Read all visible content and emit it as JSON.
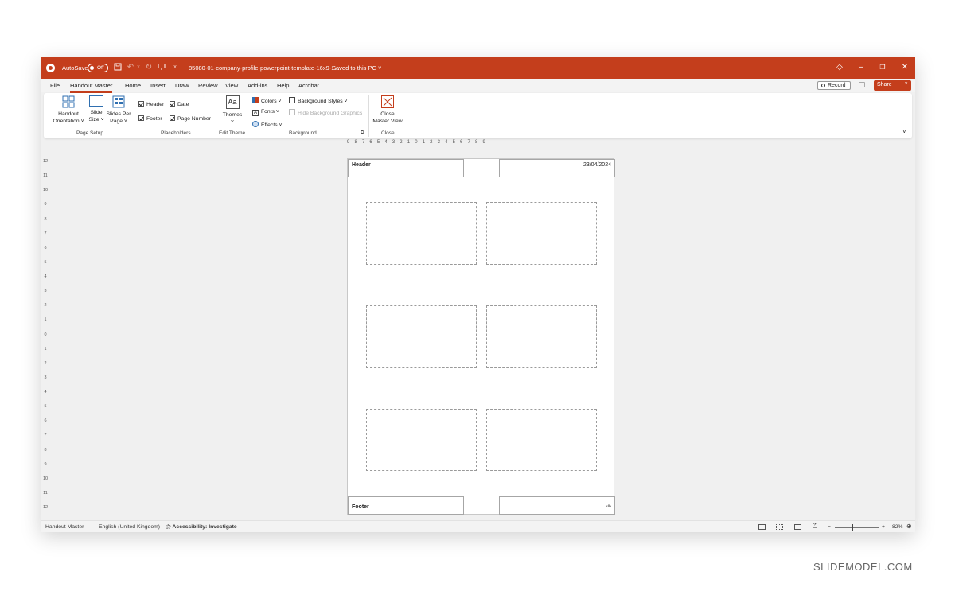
{
  "titlebar": {
    "autosave_label": "AutoSave",
    "autosave_state": "Off",
    "filename": "85080-01-company-profile-powerpoint-template-16x9-1....",
    "save_status": "Saved to this PC",
    "brand_color": "#c43e1c"
  },
  "menu": {
    "items": [
      "File",
      "Handout Master",
      "Home",
      "Insert",
      "Draw",
      "Review",
      "View",
      "Add-ins",
      "Help",
      "Acrobat"
    ],
    "active": "Handout Master",
    "record_label": "Record",
    "share_label": "Share"
  },
  "ribbon": {
    "page_setup": {
      "label": "Page Setup",
      "handout_orientation": [
        "Handout",
        "Orientation ˅"
      ],
      "slide_size": [
        "Slide",
        "Size ˅"
      ],
      "slides_per_page": [
        "Slides Per",
        "Page ˅"
      ]
    },
    "placeholders": {
      "label": "Placeholders",
      "header": "Header",
      "date": "Date",
      "footer": "Footer",
      "page_number": "Page Number"
    },
    "edit_theme": {
      "label": "Edit Theme",
      "themes": "Themes",
      "themes_arrow": "˅"
    },
    "background": {
      "label": "Background",
      "colors": "Colors ˅",
      "fonts": "Fonts ˅",
      "effects": "Effects ˅",
      "background_styles": "Background Styles ˅",
      "hide_graphics": "Hide Background Graphics"
    },
    "close": {
      "label": "Close",
      "close_master_view": [
        "Close",
        "Master View"
      ]
    }
  },
  "ruler": {
    "horizontal": "9 · 8 · 7 · 6 · 5 · 4 · 3 · 2 · 1 · 0 · 1 · 2 · 3 · 4 · 5 · 6 · 7 · 8 · 9",
    "vertical": [
      "12",
      "11",
      "10",
      "9",
      "8",
      "7",
      "6",
      "5",
      "4",
      "3",
      "2",
      "1",
      "0",
      "1",
      "2",
      "3",
      "4",
      "5",
      "6",
      "7",
      "8",
      "9",
      "10",
      "11",
      "12"
    ]
  },
  "page": {
    "header_text": "Header",
    "date_text": "23/04/2024",
    "footer_text": "Footer",
    "page_number_text": "‹#›"
  },
  "statusbar": {
    "view_name": "Handout Master",
    "language": "English (United Kingdom)",
    "accessibility": "Accessibility: Investigate",
    "zoom_minus": "−",
    "zoom_plus": "+",
    "zoom": "82%"
  },
  "watermark": "SLIDEMODEL.COM"
}
